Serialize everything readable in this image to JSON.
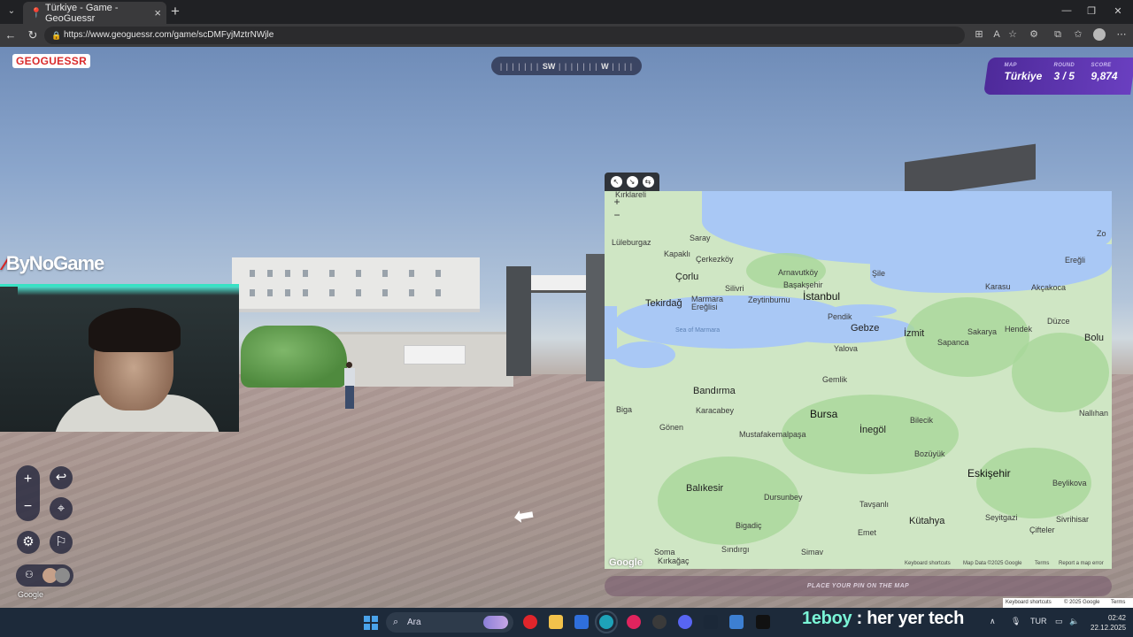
{
  "browser": {
    "tab_title": "Türkiye - Game - GeoGuessr",
    "url": "https://www.geoguessr.com/game/scDMFyjMztrNWjle"
  },
  "game": {
    "logo": "GEOGUESSR",
    "compass": {
      "left_ticks": "| | | | | | |",
      "dir1": "SW",
      "mid_ticks": "| | | | | | |",
      "dir2": "W",
      "right_ticks": "| | | |"
    },
    "score": {
      "map_label": "MAP",
      "map_value": "Türkiye",
      "round_label": "ROUND",
      "round_value": "3 / 5",
      "score_label": "SCORE",
      "score_value": "9,874"
    },
    "overlay_brand": "ByNoGame",
    "controls": {
      "zoom_in": "+",
      "zoom_out": "−",
      "back": "↩",
      "checkpoint": "⌖",
      "settings": "⚙",
      "flag": "⚐",
      "players": "⚇"
    },
    "watermark": "Google",
    "guess_button": "PLACE YOUR PIN ON THE MAP",
    "footer": {
      "shortcuts": "Keyboard shortcuts",
      "copyright": "© 2025 Google",
      "terms": "Terms"
    }
  },
  "map": {
    "zoom_in": "+",
    "zoom_out": "−",
    "places": {
      "kirklareli": "Kırklareli",
      "luleburgaz": "Lüleburgaz",
      "saray": "Saray",
      "kapakli": "Kapaklı",
      "cerkezkoy": "Çerkezköy",
      "corlu": "Çorlu",
      "silivri": "Silivri",
      "arnavutkoy": "Arnavutköy",
      "basaksehir": "Başakşehir",
      "istanbul": "İstanbul",
      "zeytinburnu": "Zeytinburnu",
      "sile": "Şile",
      "tekirdag": "Tekirdağ",
      "marmara_ereglisi": "Marmara Ereğlisi",
      "pendik": "Pendik",
      "gebze": "Gebze",
      "izmit": "İzmit",
      "sakarya": "Sakarya",
      "sapanca": "Sapanca",
      "hendek": "Hendek",
      "karasu": "Karasu",
      "akcakoca": "Akçakoca",
      "eregli": "Ereğli",
      "duzce": "Düzce",
      "bolu": "Bolu",
      "yalova": "Yalova",
      "gemlik": "Gemlik",
      "bandirma": "Bandırma",
      "karacabey": "Karacabey",
      "bursa": "Bursa",
      "biga": "Biga",
      "gonen": "Gönen",
      "mustafakemalpasa": "Mustafakemalpaşa",
      "inegol": "İnegöl",
      "bilecik": "Bilecik",
      "bozuyuk": "Bozüyük",
      "eskisehir": "Eskişehir",
      "balikesir": "Balıkesir",
      "dursunbey": "Dursunbey",
      "tavsanli": "Tavşanlı",
      "kutahya": "Kütahya",
      "bigadic": "Bigadiç",
      "emet": "Emet",
      "simav": "Simav",
      "soma": "Soma",
      "kirkagac": "Kırkağaç",
      "sindirgi": "Sındırgı",
      "seyitgazi": "Seyitgazi",
      "cifteler": "Çifteler",
      "sivrihisar": "Sivrihisar",
      "beylikova": "Beylikova",
      "nallihan": "Nallıhan",
      "sea_of_marmara": "Sea of Marmara",
      "gebze_small": "Zo"
    },
    "google": "Google",
    "footer": {
      "shortcuts": "Keyboard shortcuts",
      "data": "Map Data ©2025 Google",
      "terms": "Terms",
      "report": "Report a map error"
    }
  },
  "taskbar": {
    "search_placeholder": "Ara",
    "overlay_name": "1eboy",
    "overlay_tagline": ": her yer tech",
    "language": "TUR",
    "time": "02:42",
    "date": "22.12.2025"
  }
}
